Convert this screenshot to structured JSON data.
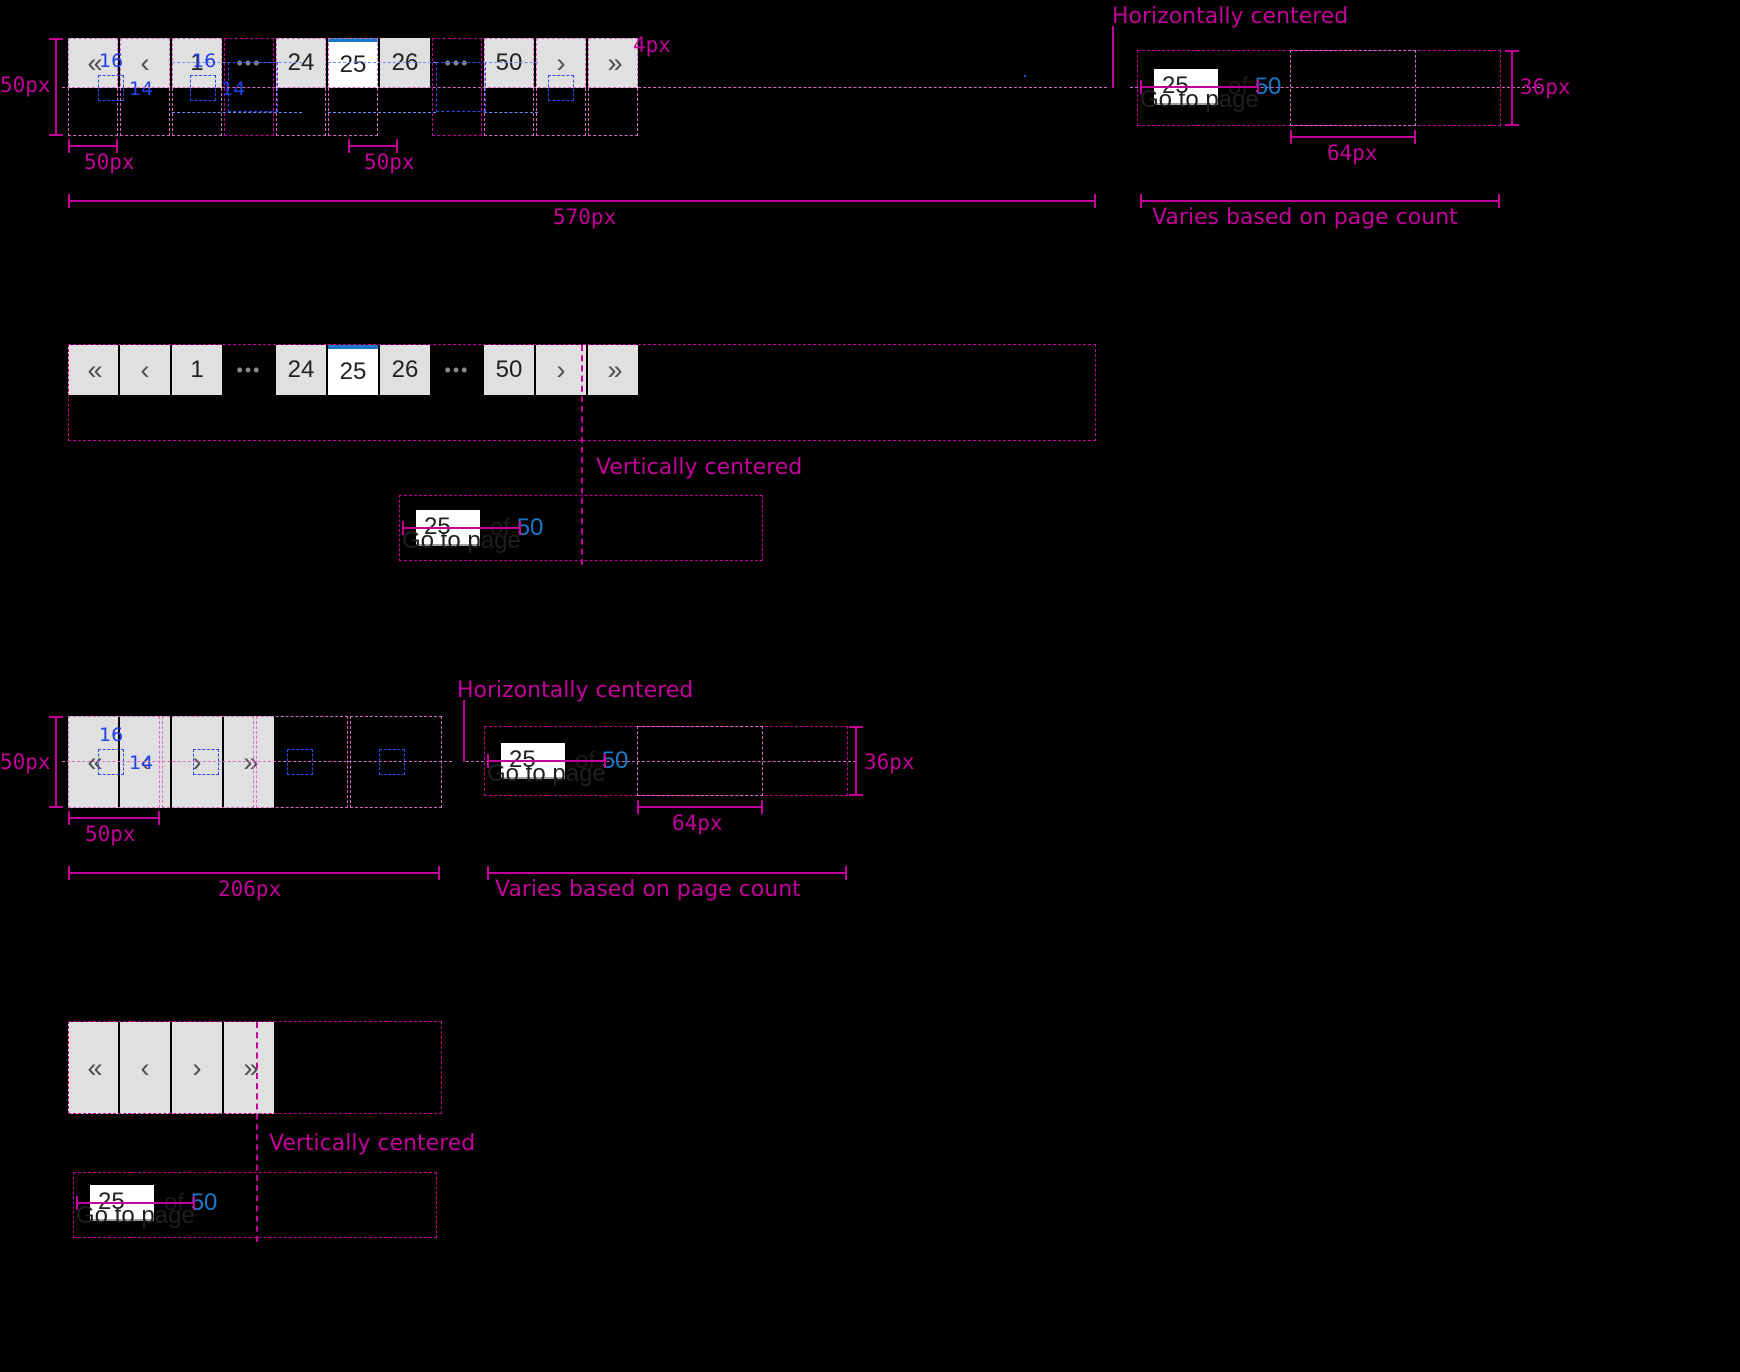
{
  "icons": {
    "first_page": "«",
    "prev_page": "‹",
    "next_page": "›",
    "last_page": "»",
    "ellipsis": "•••"
  },
  "colors": {
    "annotation_magenta": "#c4009a",
    "annotation_blue": "#2b4df0",
    "active_accent": "#1878c8",
    "button_bg": "#e0e0e0",
    "current_bg": "#ffffff",
    "page_count_blue": "#1878c8"
  },
  "pagination_full": {
    "pages": [
      "1",
      "…",
      "24",
      "25",
      "26",
      "…",
      "50"
    ],
    "current_page": "25",
    "items": [
      {
        "type": "icon",
        "label": "«",
        "name": "first-page"
      },
      {
        "type": "icon",
        "label": "‹",
        "name": "prev-page"
      },
      {
        "type": "page",
        "label": "1"
      },
      {
        "type": "ellipsis",
        "label": "•••"
      },
      {
        "type": "page",
        "label": "24"
      },
      {
        "type": "current",
        "label": "25"
      },
      {
        "type": "page",
        "label": "26"
      },
      {
        "type": "ellipsis",
        "label": "•••"
      },
      {
        "type": "page",
        "label": "50"
      },
      {
        "type": "icon",
        "label": "›",
        "name": "next-page"
      },
      {
        "type": "icon",
        "label": "»",
        "name": "last-page"
      }
    ]
  },
  "pagination_compact": {
    "items": [
      {
        "type": "icon",
        "label": "«",
        "name": "first-page"
      },
      {
        "type": "icon",
        "label": "‹",
        "name": "prev-page"
      },
      {
        "type": "icon",
        "label": "›",
        "name": "next-page"
      },
      {
        "type": "icon",
        "label": "»",
        "name": "last-page"
      }
    ]
  },
  "goto": {
    "label": "Go to page",
    "value": "25",
    "of_label": "of",
    "total_pages": "50"
  },
  "annotations": {
    "height_50px": "50px",
    "width_50px": "50px",
    "icon_box_16": "16",
    "icon_box_14": "14",
    "active_border_4px": "4px",
    "total_570px": "570px",
    "total_206px": "206px",
    "input_64px": "64px",
    "goto_height_36px": "36px",
    "horizontally_centered": "Horizontally centered",
    "vertically_centered": "Vertically centered",
    "varies": "Varies based on page count"
  }
}
